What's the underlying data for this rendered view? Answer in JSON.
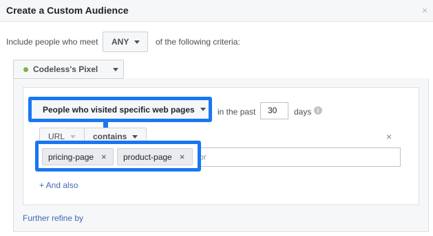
{
  "dialog": {
    "title": "Create a Custom Audience",
    "close_label": "×"
  },
  "criteria": {
    "prefix": "Include people who meet",
    "match_value": "ANY",
    "suffix": "of the following criteria:"
  },
  "pixel": {
    "name": "Codeless's Pixel",
    "status_color": "#7cb342"
  },
  "rule": {
    "event": "People who visited specific web pages",
    "past_label": "in the past",
    "days_value": "30",
    "days_label": "days",
    "field": "URL",
    "operator": "contains",
    "tags": [
      {
        "label": "pricing-page",
        "remove_icon": "×"
      },
      {
        "label": "product-page",
        "remove_icon": "×"
      }
    ],
    "input_tail": "or",
    "remove_rule_label": "×",
    "and_also": "+ And also"
  },
  "further_refine": "Further refine by",
  "colors": {
    "highlight": "#1877f2",
    "link": "#4267b2"
  },
  "icons": {
    "info": "info-icon",
    "caret": "caret-down-icon"
  }
}
